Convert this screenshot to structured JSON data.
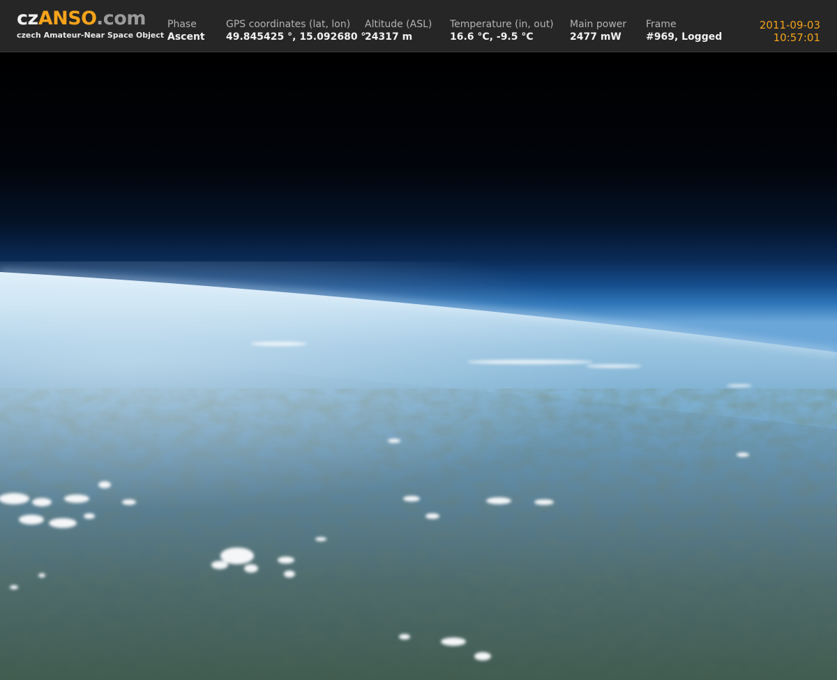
{
  "header": {
    "logo": {
      "part_cz": "cz",
      "part_anso": "ANSO",
      "part_domain": ".com",
      "subtitle": "czech Amateur-Near Space Object"
    },
    "fields": [
      {
        "label": "Phase",
        "value": "Ascent"
      },
      {
        "label": "GPS coordinates (lat, lon)",
        "value": "49.845425 °, 15.092680 °"
      },
      {
        "label": "Altitude (ASL)",
        "value": "24317 m"
      },
      {
        "label": "Temperature (in, out)",
        "value": "16.6 °C, -9.5 °C"
      },
      {
        "label": "Main power",
        "value": "2477 mW"
      },
      {
        "label": "Frame",
        "value": "#969, Logged"
      }
    ],
    "date": "2011-09-03",
    "time": "10:57:01"
  },
  "colors": {
    "header_bg": "#262626",
    "accent_orange": "#f5a31a",
    "label_gray": "#b4b4b4",
    "value_white": "#f2f2f2"
  },
  "photo": {
    "subject": "earth-horizon-from-stratosphere"
  }
}
